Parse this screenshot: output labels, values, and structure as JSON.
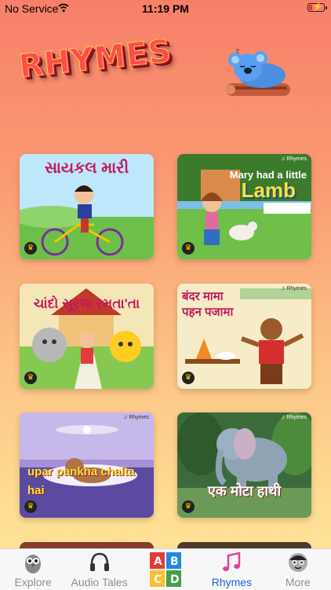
{
  "status_bar": {
    "carrier": "No Service",
    "time": "11:19 PM"
  },
  "header": {
    "title": "RHYMES"
  },
  "cards": [
    {
      "title": "સાયકલ મારી",
      "tag": ""
    },
    {
      "title": "Mary had a little",
      "title2": "Lamb",
      "tag": "♫ Rhymes"
    },
    {
      "title": "ચાંદો સૂરજ રમતા'તા",
      "tag": ""
    },
    {
      "title": "बंदर मामा",
      "title2": "पहन पजामा",
      "tag": "♫ Rhymes"
    },
    {
      "title": "upar pankha chalta hai",
      "tag": "♫ Rhymes"
    },
    {
      "title": "एक मोटा हाथी",
      "tag": "♫ Rhymes"
    }
  ],
  "tabs": [
    {
      "label": "Explore",
      "icon": "owl-icon"
    },
    {
      "label": "Audio Tales",
      "icon": "headphones-icon"
    },
    {
      "label": "",
      "icon": "abcd-blocks-icon"
    },
    {
      "label": "Rhymes",
      "icon": "music-note-icon",
      "active": true
    },
    {
      "label": "More",
      "icon": "face-icon"
    }
  ],
  "colors": {
    "accent": "#1565e8",
    "inactive": "#8e8e93"
  }
}
